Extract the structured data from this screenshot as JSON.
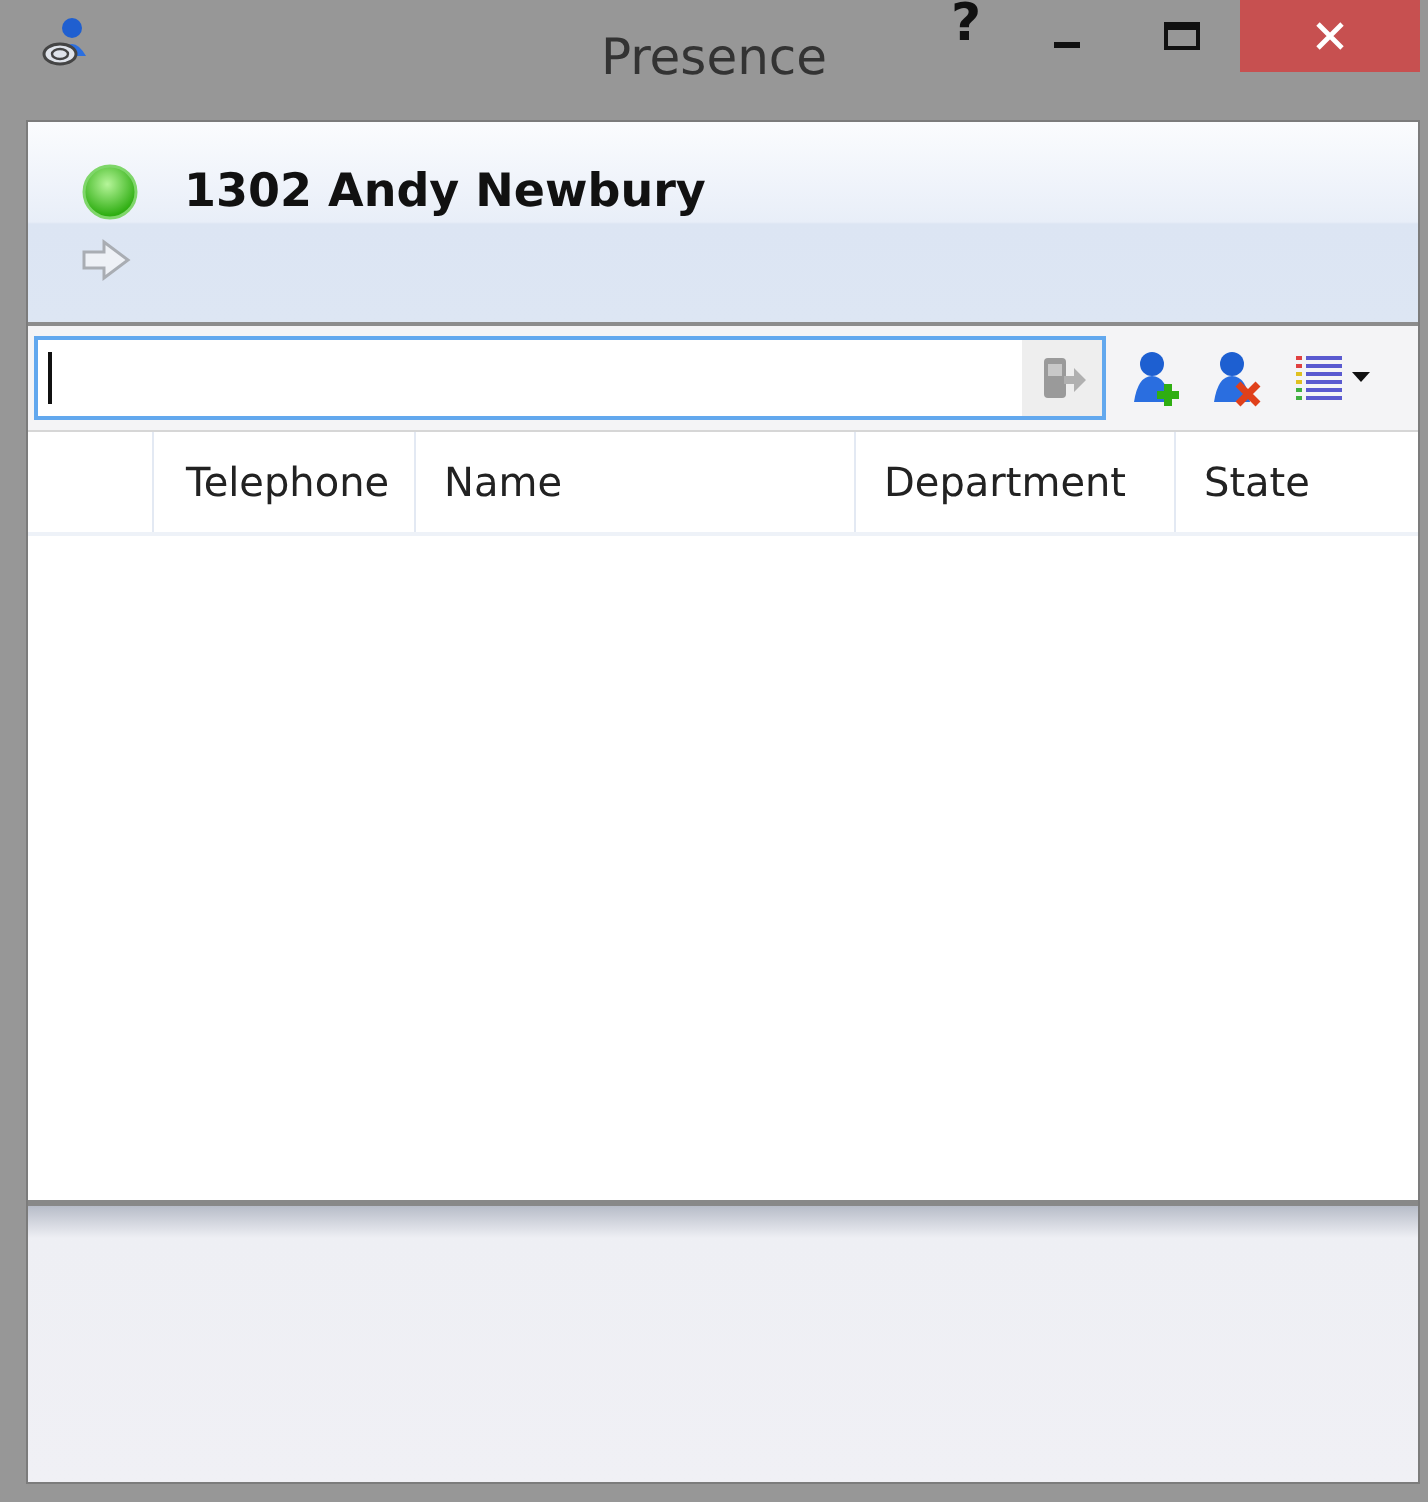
{
  "window": {
    "title": "Presence",
    "controls": [
      "?"
    ]
  },
  "user": {
    "label": "1302 Andy Newbury"
  },
  "table": {
    "columns": [
      "Telephone",
      "Name",
      "Department",
      "State"
    ]
  }
}
